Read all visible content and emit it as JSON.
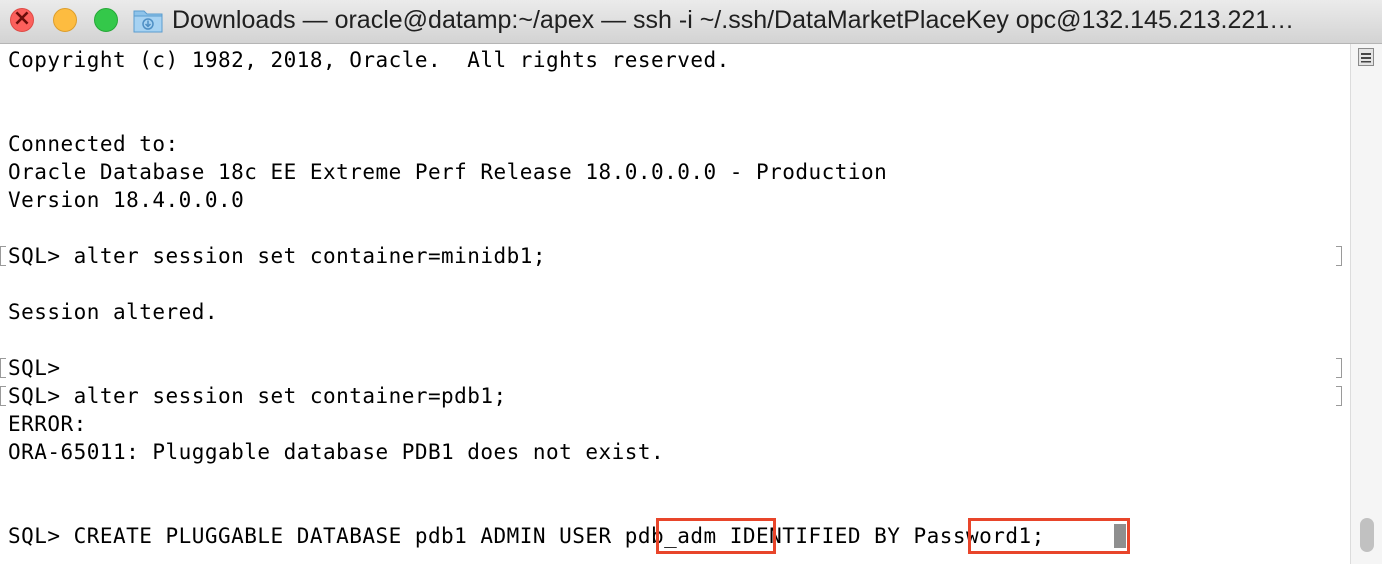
{
  "window": {
    "title": "Downloads — oracle@datamp:~/apex — ssh -i ~/.ssh/DataMarketPlaceKey opc@132.145.213.221…"
  },
  "terminal": {
    "lines": [
      "Copyright (c) 1982, 2018, Oracle.  All rights reserved.",
      "",
      "",
      "Connected to:",
      "Oracle Database 18c EE Extreme Perf Release 18.0.0.0.0 - Production",
      "Version 18.4.0.0.0",
      "",
      "SQL> alter session set container=minidb1;",
      "",
      "Session altered.",
      "",
      "SQL>",
      "SQL> alter session set container=pdb1;",
      "ERROR:",
      "ORA-65011: Pluggable database PDB1 does not exist.",
      "",
      "",
      "SQL> CREATE PLUGGABLE DATABASE pdb1 ADMIN USER pdb_adm IDENTIFIED BY Password1;"
    ],
    "highlights": [
      "pdb_adm",
      "Password1;"
    ]
  },
  "colors": {
    "highlight_border": "#e8452a",
    "cursor": "#8f8f8f"
  },
  "icons": {
    "folder": "folder-downloads-icon",
    "scroll_menu": "scroll-menu-icon"
  }
}
